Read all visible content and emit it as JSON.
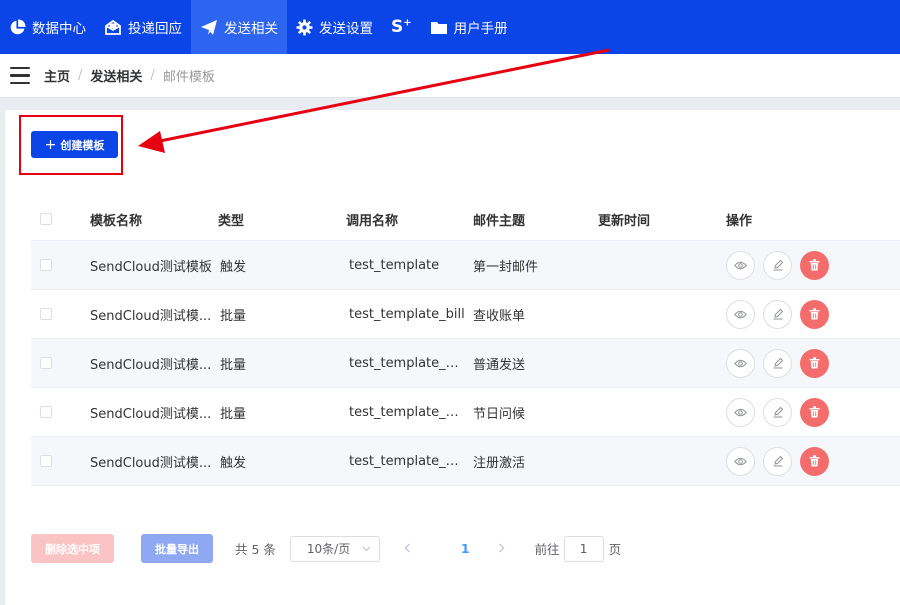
{
  "topnav": {
    "items": [
      {
        "label": "数据中心",
        "icon": "pie-chart-icon"
      },
      {
        "label": "投递回应",
        "icon": "envelope-open-icon"
      },
      {
        "label": "发送相关",
        "icon": "paper-plane-icon",
        "active": true
      },
      {
        "label": "发送设置",
        "icon": "gear-icon"
      },
      {
        "label": "S",
        "icon": "sendcloud-plus-icon"
      },
      {
        "label": "用户手册",
        "icon": "folder-icon"
      }
    ]
  },
  "breadcrumb": {
    "items": [
      "主页",
      "发送相关",
      "邮件模板"
    ],
    "separator": "/"
  },
  "toolbar": {
    "create_label": "创建模板",
    "create_icon": "plus-icon"
  },
  "table": {
    "headers": [
      "模板名称",
      "类型",
      "调用名称",
      "邮件主题",
      "更新时间",
      "操作"
    ],
    "rows": [
      {
        "name": "SendCloud测试模板",
        "type": "触发",
        "call": "test_template",
        "subject": "第一封邮件",
        "time": ""
      },
      {
        "name": "SendCloud测试模...",
        "type": "批量",
        "call": "test_template_bill",
        "subject": "查收账单",
        "time": ""
      },
      {
        "name": "SendCloud测试模...",
        "type": "批量",
        "call": "test_template_se...",
        "subject": "普通发送",
        "time": ""
      },
      {
        "name": "SendCloud测试模...",
        "type": "批量",
        "call": "test_template_gr...",
        "subject": "节日问候",
        "time": ""
      },
      {
        "name": "SendCloud测试模...",
        "type": "触发",
        "call": "test_template_ac...",
        "subject": "注册激活",
        "time": ""
      }
    ],
    "row_actions": [
      "eye-icon",
      "edit-icon",
      "trash-icon"
    ]
  },
  "pagination": {
    "delete_selected_label": "删除选中项",
    "export_label": "批量导出",
    "total_label": "共 5 条",
    "page_size_label": "10条/页",
    "current_page": "1",
    "goto_label": "前往",
    "goto_value": "1",
    "page_unit": "页"
  },
  "colors": {
    "brand": "#0b45e8",
    "annotation_red": "#e60012",
    "danger": "#f56c6c"
  }
}
